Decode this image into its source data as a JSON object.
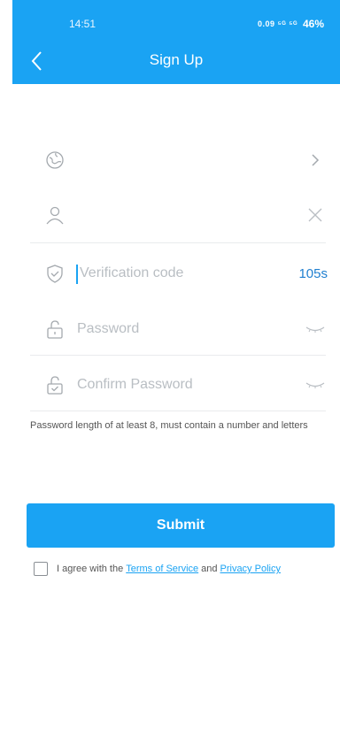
{
  "status_bar": {
    "time": "14:51",
    "signal_text": "0.09 ⁵ᴳ ⁵ᴳ",
    "battery": "46%"
  },
  "header": {
    "title": "Sign Up"
  },
  "form": {
    "region": {
      "icon": "globe-icon",
      "trailing_icon": "chevron-right-icon"
    },
    "account": {
      "icon": "user-icon",
      "trailing_icon": "clear-icon"
    },
    "verification": {
      "icon": "shield-check-icon",
      "placeholder": "Verification code",
      "countdown": "105s"
    },
    "password": {
      "icon": "lock-icon",
      "placeholder": "Password",
      "trailing_icon": "eye-closed-icon"
    },
    "confirm_password": {
      "icon": "lock-check-icon",
      "placeholder": "Confirm Password",
      "trailing_icon": "eye-closed-icon"
    },
    "hint": "Password length of at least 8, must contain a number and letters"
  },
  "submit_label": "Submit",
  "agreement": {
    "prefix": "I agree with the",
    "terms": "Terms of Service",
    "middle": "and",
    "privacy": "Privacy Policy",
    "checked": false
  },
  "colors": {
    "accent": "#1aa3f3",
    "countdown": "#1f7fd0",
    "divider": "#e9ebed"
  }
}
